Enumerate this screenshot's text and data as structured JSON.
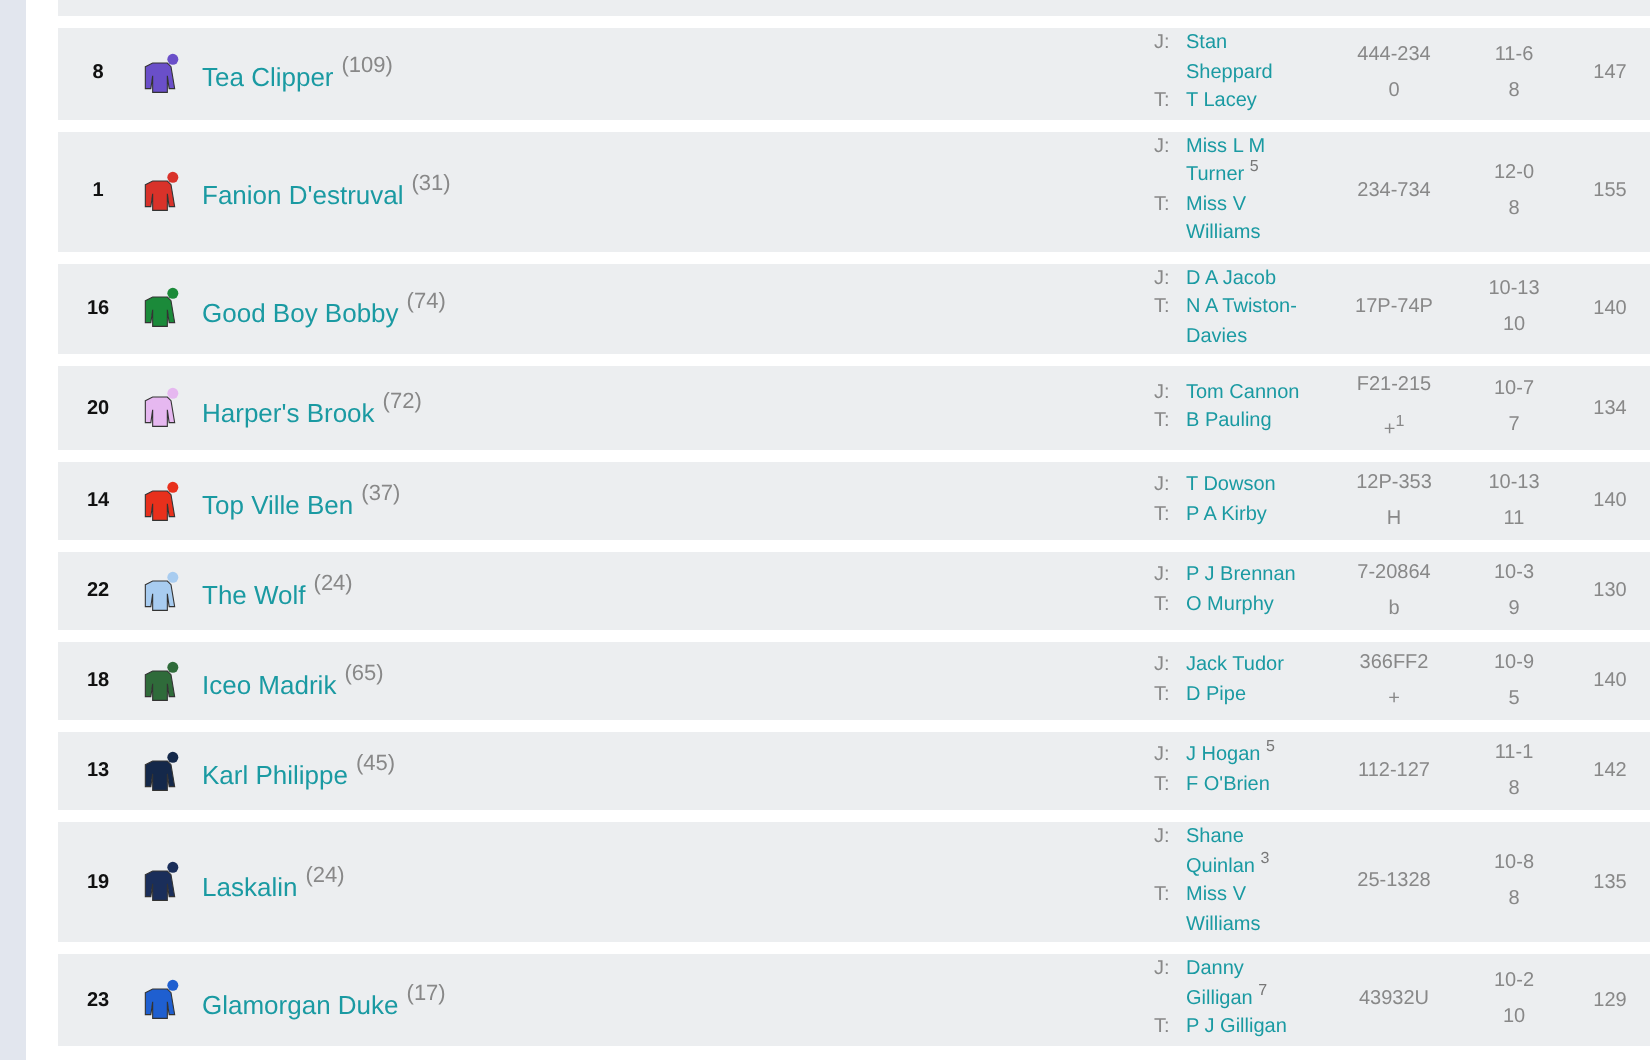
{
  "runners": [
    {
      "number": "8",
      "name": "Tea Clipper",
      "rating": "(109)",
      "color": "#6a4fc9",
      "jockey_label": "J:",
      "jockey": "Stan Sheppard",
      "trainer_label": "T:",
      "trainer": "T Lacey",
      "form_lines": [
        "444-234",
        "0"
      ],
      "weight": "11-6",
      "age": "8",
      "official_rating": "147"
    },
    {
      "number": "1",
      "name": "Fanion D'estruval",
      "rating": "(31)",
      "color": "#d9322a",
      "jockey_label": "J:",
      "jockey": "Miss L M Turner $^{5}$",
      "trainer_label": "T:",
      "trainer": "Miss V Williams",
      "form_lines": [
        "234-734"
      ],
      "weight": "12-0",
      "age": "8",
      "official_rating": "155"
    },
    {
      "number": "16",
      "name": "Good Boy Bobby",
      "rating": "(74)",
      "color": "#1b8a3a",
      "jockey_label": "J:",
      "jockey": "D A Jacob",
      "trainer_label": "T:",
      "trainer": "N A Twiston-Davies",
      "form_lines": [
        "17P-74P"
      ],
      "weight": "10-13",
      "age": "10",
      "official_rating": "140"
    },
    {
      "number": "20",
      "name": "Harper's Brook",
      "rating": "(72)",
      "color": "#e6b8f0",
      "jockey_label": "J:",
      "jockey": "Tom Cannon",
      "trainer_label": "T:",
      "trainer": "B Pauling",
      "form_lines": [
        "F21-215",
        "+$^{1}$"
      ],
      "weight": "10-7",
      "age": "7",
      "official_rating": "134"
    },
    {
      "number": "14",
      "name": "Top Ville Ben",
      "rating": "(37)",
      "color": "#e8301c",
      "jockey_label": "J:",
      "jockey": "T Dowson",
      "trainer_label": "T:",
      "trainer": "P A Kirby",
      "form_lines": [
        "12P-353",
        "H"
      ],
      "weight": "10-13",
      "age": "11",
      "official_rating": "140"
    },
    {
      "number": "22",
      "name": "The Wolf",
      "rating": "(24)",
      "color": "#a8ccf0",
      "jockey_label": "J:",
      "jockey": "P J Brennan",
      "trainer_label": "T:",
      "trainer": "O Murphy",
      "form_lines": [
        "7-20864",
        "b"
      ],
      "weight": "10-3",
      "age": "9",
      "official_rating": "130"
    },
    {
      "number": "18",
      "name": "Iceo Madrik",
      "rating": "(65)",
      "color": "#2f6b3a",
      "jockey_label": "J:",
      "jockey": "Jack Tudor",
      "trainer_label": "T:",
      "trainer": "D Pipe",
      "form_lines": [
        "366FF2",
        "+"
      ],
      "weight": "10-9",
      "age": "5",
      "official_rating": "140"
    },
    {
      "number": "13",
      "name": "Karl Philippe",
      "rating": "(45)",
      "color": "#14284a",
      "jockey_label": "J:",
      "jockey": "J Hogan $^{5}$",
      "trainer_label": "T:",
      "trainer": "F O'Brien",
      "form_lines": [
        "112-127"
      ],
      "weight": "11-1",
      "age": "8",
      "official_rating": "142"
    },
    {
      "number": "19",
      "name": "Laskalin",
      "rating": "(24)",
      "color": "#1a2e5a",
      "jockey_label": "J:",
      "jockey": "Shane Quinlan $^{3}$",
      "trainer_label": "T:",
      "trainer": "Miss V Williams",
      "form_lines": [
        "25-1328"
      ],
      "weight": "10-8",
      "age": "8",
      "official_rating": "135"
    },
    {
      "number": "23",
      "name": "Glamorgan Duke",
      "rating": "(17)",
      "color": "#1f5fd0",
      "jockey_label": "J:",
      "jockey": "Danny Gilligan $^{7}$",
      "trainer_label": "T:",
      "trainer": "P J Gilligan",
      "form_lines": [
        "43932U"
      ],
      "weight": "10-2",
      "age": "10",
      "official_rating": "129"
    }
  ]
}
